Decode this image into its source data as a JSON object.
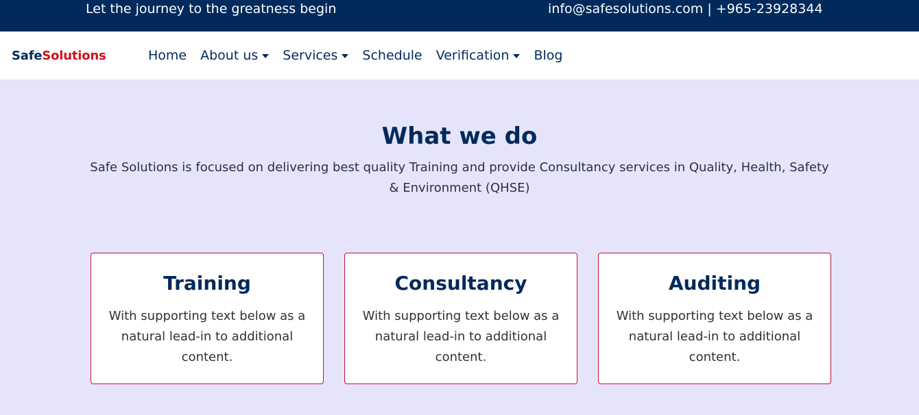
{
  "topbar": {
    "tagline": "Let the journey to the greatness begin",
    "contact": "info@safesolutions.com | +965-23928344"
  },
  "brand": {
    "part1": "Safe",
    "part2": "Solutions"
  },
  "nav": {
    "items": [
      {
        "label": "Home"
      },
      {
        "label": "About us"
      },
      {
        "label": "Services"
      },
      {
        "label": "Schedule"
      },
      {
        "label": "Verification"
      },
      {
        "label": "Blog"
      }
    ]
  },
  "hero": {
    "title": "What we do",
    "subtitle": "Safe Solutions is focused on delivering best quality Training and provide Consultancy services in Quality, Health, Safety & Environment (QHSE)"
  },
  "cards": [
    {
      "title": "Training",
      "text": "With supporting text below as a natural lead-in to additional content."
    },
    {
      "title": "Consultancy",
      "text": "With supporting text below as a natural lead-in to additional content."
    },
    {
      "title": "Auditing",
      "text": "With supporting text below as a natural lead-in to additional content."
    }
  ],
  "colors": {
    "topbar_bg": "#002a5c",
    "brand_accent": "#d0101a",
    "page_bg": "#e5e4fb",
    "card_border": "#c8102e"
  }
}
